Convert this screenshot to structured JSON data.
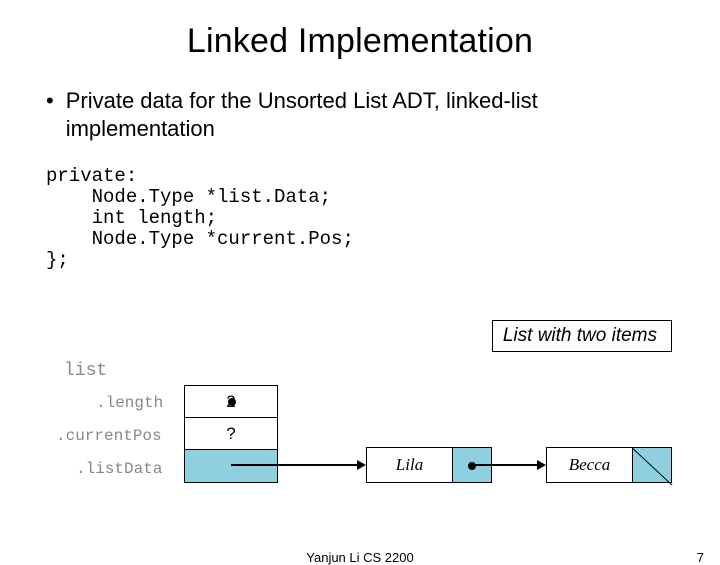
{
  "title": "Linked Implementation",
  "bullet_text": "Private data for the Unsorted List ADT, linked-list implementation",
  "caption": "List with two items",
  "footer_center": "Yanjun Li CS 2200",
  "footer_page": "7",
  "code": {
    "l1": "private:",
    "l2": "    Node.Type *list.Data;",
    "l3": "    int length;",
    "l4": "    Node.Type *current.Pos;",
    "l5": "};"
  },
  "diagram": {
    "list_label": "list",
    "field_length": ".length",
    "field_currentPos": ".currentPos",
    "field_listData": ".listData",
    "length_value": "2",
    "currentPos_value": "?",
    "node1_info": "Lila",
    "node2_info": "Becca"
  }
}
